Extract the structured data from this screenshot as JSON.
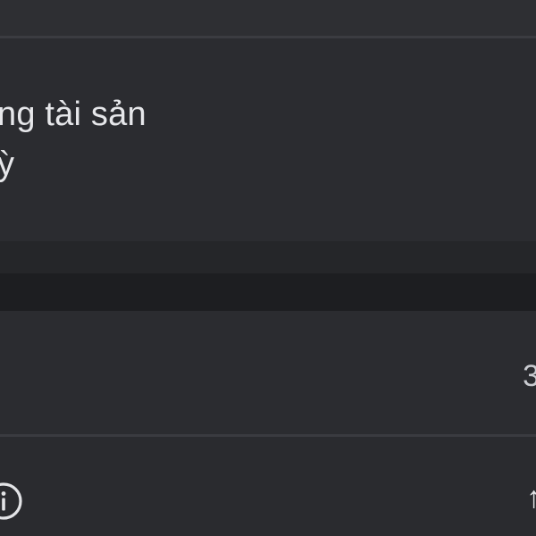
{
  "dialog": {
    "title_line1": "ng tài sản",
    "title_line2": "ỳ"
  },
  "list_row": {
    "trailing_glyph": "3"
  },
  "footer": {
    "info_icon": "info-icon",
    "trailing_glyph": "↑"
  },
  "colors": {
    "background": "#2b2c30",
    "section_header": "#252629",
    "dark_bar": "#1d1e21",
    "text_primary": "#e6e7ea"
  }
}
